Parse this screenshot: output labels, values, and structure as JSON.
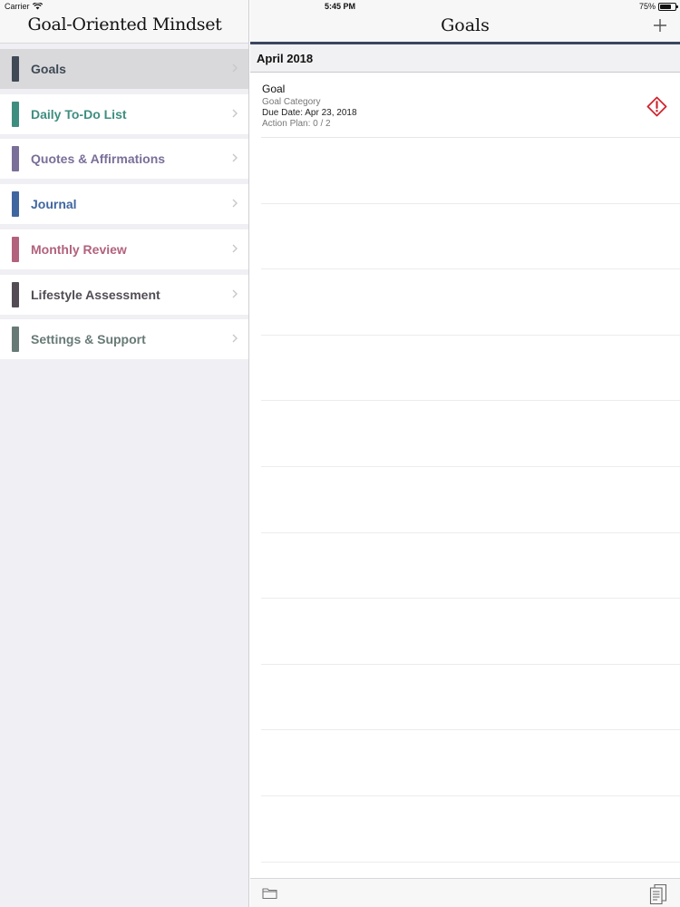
{
  "status_bar": {
    "carrier": "Carrier",
    "time": "5:45 PM",
    "battery": "75%",
    "battery_level": 0.75
  },
  "sidebar": {
    "title": "Goal-Oriented Mindset",
    "items": [
      {
        "label": "Goals",
        "color": "#3f4a55",
        "selected": true
      },
      {
        "label": "Daily To-Do List",
        "color": "#3e8e80"
      },
      {
        "label": "Quotes & Affirmations",
        "color": "#7a6f99"
      },
      {
        "label": "Journal",
        "color": "#4066a0"
      },
      {
        "label": "Monthly Review",
        "color": "#b2627c"
      },
      {
        "label": "Lifestyle Assessment",
        "color": "#534c55"
      },
      {
        "label": "Settings & Support",
        "color": "#677a76"
      }
    ]
  },
  "main": {
    "title": "Goals",
    "add_icon": "plus-icon",
    "section_label": "April 2018",
    "goals": [
      {
        "name": "Goal",
        "category": "Goal Category",
        "due": "Due Date: Apr 23, 2018",
        "plan": "Action Plan:  0 / 2",
        "status_icon": "warning-diamond-icon",
        "status_color": "#d0202a"
      }
    ],
    "toolbar": {
      "left_icon": "folder-icon",
      "right_icon": "documents-icon"
    }
  },
  "colors": {
    "header_rule": "#3a4660",
    "sidebar_bg": "#efeff4"
  }
}
